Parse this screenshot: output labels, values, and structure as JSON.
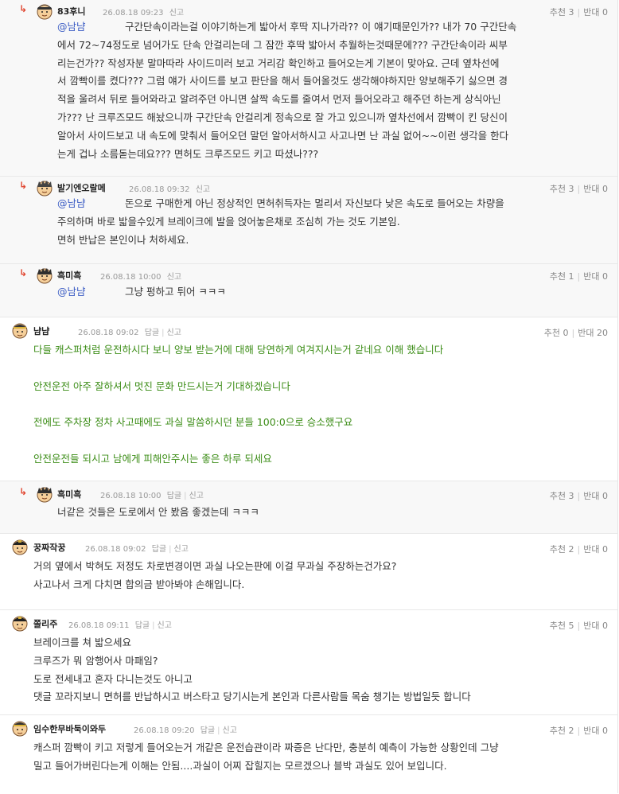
{
  "comments": [
    {
      "nick": "83후니",
      "date": "26.08.18 09:23",
      "report": "신고",
      "recommend": "추천 3",
      "oppose": "반대 0",
      "mention": "@남냠",
      "text": "구간단속이라는걸 이야기하는게 밟아서 후딱 지나가라?? 이 얘기때문인가?? 내가 70 구간단속\n에서 72~74정도로 넘어가도 단속 안걸리는데 그 잠깐 후딱 밟아서 추월하는것때문에??? 구간단속이라 씨부\n리는건가?? 작성자분 말마따라 사이드미러 보고 거리감 확인하고 들어오는게 기본이 맞아요. 근데 옆차선에\n서 깜빡이를 켰다??? 그럼 얘가 사이드를 보고 판단을 해서 들어올것도 생각해야하지만 양보해주기 싫으면 경\n적을 울려서 뒤로 들어와라고 알려주던 아니면 살짝 속도를 줄여서 먼저 들어오라고 해주던 하는게 상식아닌\n가??? 난 크루즈모드 해놨으니까 구간단속 안걸리게 정속으로 잘 가고 있으니까 옆차선에서 깜빡이 킨 당신이\n알아서 사이드보고 내 속도에 맞춰서 들어오던 말던 알아서하시고 사고나면 난 과실 없어~~이런 생각을 한다\n는게 겁나 소름돋는데요??? 면허도 크루즈모드 키고 따셨나???"
    },
    {
      "nick": "발기엔오랄메",
      "date": "26.08.18 09:32",
      "report": "신고",
      "recommend": "추천 3",
      "oppose": "반대 0",
      "mention": "@남냠",
      "text": "돈으로 구매한게 아닌 정상적인 면허취득자는 멀리서 자신보다 낮은 속도로 들어오는 차량을\n주의하며 바로 밟을수있게 브레이크에 발을 얹어놓은채로 조심히 가는 것도 기본임.\n면허 반납은 본인이나 처하세요."
    },
    {
      "nick": "흑미흑",
      "date": "26.08.18 10:00",
      "report": "신고",
      "recommend": "추천 1",
      "oppose": "반대 0",
      "mention": "@남냠",
      "text": "그냥 펑하고 튀어 ㅋㅋㅋ"
    },
    {
      "nick": "냠냠",
      "date": "26.08.18 09:02",
      "reply": "답글",
      "report": "신고",
      "recommend": "추천 0",
      "oppose": "반대 20",
      "text": "다들 캐스퍼처럼 운전하시다 보니 양보 받는거에 대해 당연하게 여겨지시는거 같네요 이해 했습니다\n\n안전운전 아주 잘하셔서 멋진 문화 만드시는거 기대하겠습니다\n\n전에도 주차장 정차 사고때에도 과실 말씀하시던 분들 100:0으로 승소했구요\n\n안전운전들 되시고 남에게 피해안주시는 좋은 하루 되세요"
    },
    {
      "nick": "흑미흑",
      "date": "26.08.18 10:00",
      "reply": "답글",
      "report": "신고",
      "recommend": "추천 3",
      "oppose": "반대 0",
      "text": "너같은 것들은 도로에서 안 봤음 좋겠는데 ㅋㅋㅋ"
    },
    {
      "nick": "꿍짜작꿍",
      "date": "26.08.18 09:02",
      "reply": "답글",
      "report": "신고",
      "recommend": "추천 2",
      "oppose": "반대 0",
      "text": "거의 옆에서 박혀도 저정도 차로변경이면 과실 나오는판에 이걸 무과실 주장하는건가요?\n사고나서 크게 다치면 합의금 받아봐야 손해입니다."
    },
    {
      "nick": "쫄리주",
      "date": "26.08.18 09:11",
      "reply": "답글",
      "report": "신고",
      "recommend": "추천 5",
      "oppose": "반대 0",
      "text": "브레이크를 쳐 밟으세요\n크루즈가 뭐 암행어사 마패임?\n도로 전세내고 혼자 다니는것도 아니고\n댓글 꼬라지보니 면허를 반납하시고 버스타고 당기시는게 본인과 다른사람들 목숨 챙기는 방법일듯 합니다"
    },
    {
      "nick": "임수한무바둑이와두",
      "date": "26.08.18 09:20",
      "reply": "답글",
      "report": "신고",
      "recommend": "추천 2",
      "oppose": "반대 0",
      "text": "캐스퍼 깜빡이 키고 저렇게 들어오는거 개같은 운전습관이라 짜증은 난다만, 충분히 예측이 가능한 상황인데 그냥\n밀고 들어가버린다는게 이해는 안됨....과실이 어찌 잡힐지는 모르겠으나 블박 과실도 있어 보입니다."
    }
  ]
}
